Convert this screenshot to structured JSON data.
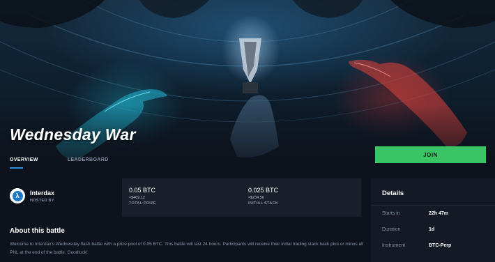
{
  "battle": {
    "title": "Wednesday War"
  },
  "tabs": [
    {
      "label": "OVERVIEW"
    },
    {
      "label": "LEADERBOARD"
    }
  ],
  "join_button": {
    "label": "JOIN"
  },
  "host": {
    "name": "Interdax",
    "label": "HOSTED BY",
    "logo_glyph": "λ"
  },
  "stats": {
    "prize": {
      "value": "0.05 BTC",
      "usd": "≈$469.12",
      "label": "TOTAL PRIZE"
    },
    "stack": {
      "value": "0.025 BTC",
      "usd": "≈$234.56",
      "label": "INITIAL STACK"
    }
  },
  "about": {
    "title": "About this battle",
    "text": "Welcome to Interdax's Wednesday flash battle with a prize pool of 0.05 BTC. This battle will last 24 hours. Participants will receive their initial trading stack back plus or minus all PNL at the end of the battle. Goodluck!"
  },
  "details": {
    "title": "Details",
    "rows": [
      {
        "label": "Starts in",
        "value": "22h 47m"
      },
      {
        "label": "Duration",
        "value": "1d"
      },
      {
        "label": "Instrument",
        "value": "BTC-Perp"
      }
    ]
  },
  "colors": {
    "accent": "#2f8fe0",
    "join": "#3bc464",
    "background": "#0d121c",
    "panel": "#1a1f2b"
  }
}
